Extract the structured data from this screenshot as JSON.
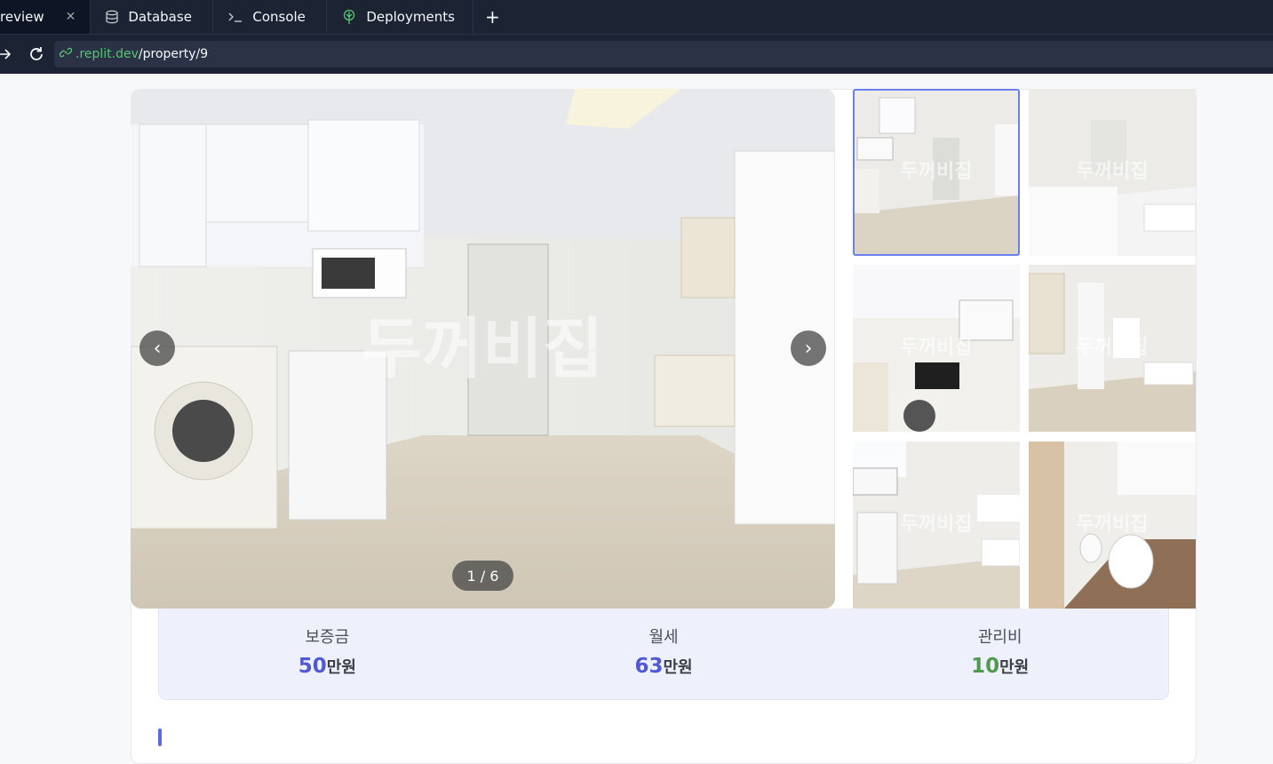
{
  "tabs": [
    {
      "label": "review",
      "icon": "",
      "active": true
    },
    {
      "label": "Database",
      "icon": "database-icon"
    },
    {
      "label": "Console",
      "icon": "console-icon"
    },
    {
      "label": "Deployments",
      "icon": "deployments-icon"
    }
  ],
  "tab_add_label": "+",
  "tab_close_label": "✕",
  "url": {
    "host": ".replit.dev",
    "path": "/property/9"
  },
  "gallery": {
    "counter": "1 / 6",
    "prev_label": "‹",
    "next_label": "›",
    "watermark": "두꺼비집",
    "selected_thumb": 0,
    "thumb_count": 6
  },
  "prices": [
    {
      "label": "보증금",
      "amount": "50",
      "unit": "만원",
      "color": "#5158d6"
    },
    {
      "label": "월세",
      "amount": "63",
      "unit": "만원",
      "color": "#5158d6"
    },
    {
      "label": "관리비",
      "amount": "10",
      "unit": "만원",
      "color": "#4f9a4f"
    }
  ],
  "colors": {
    "accent": "#5a6be0",
    "thumb_selected": "#6b7ff0",
    "chrome_bg": "#1c2333"
  }
}
